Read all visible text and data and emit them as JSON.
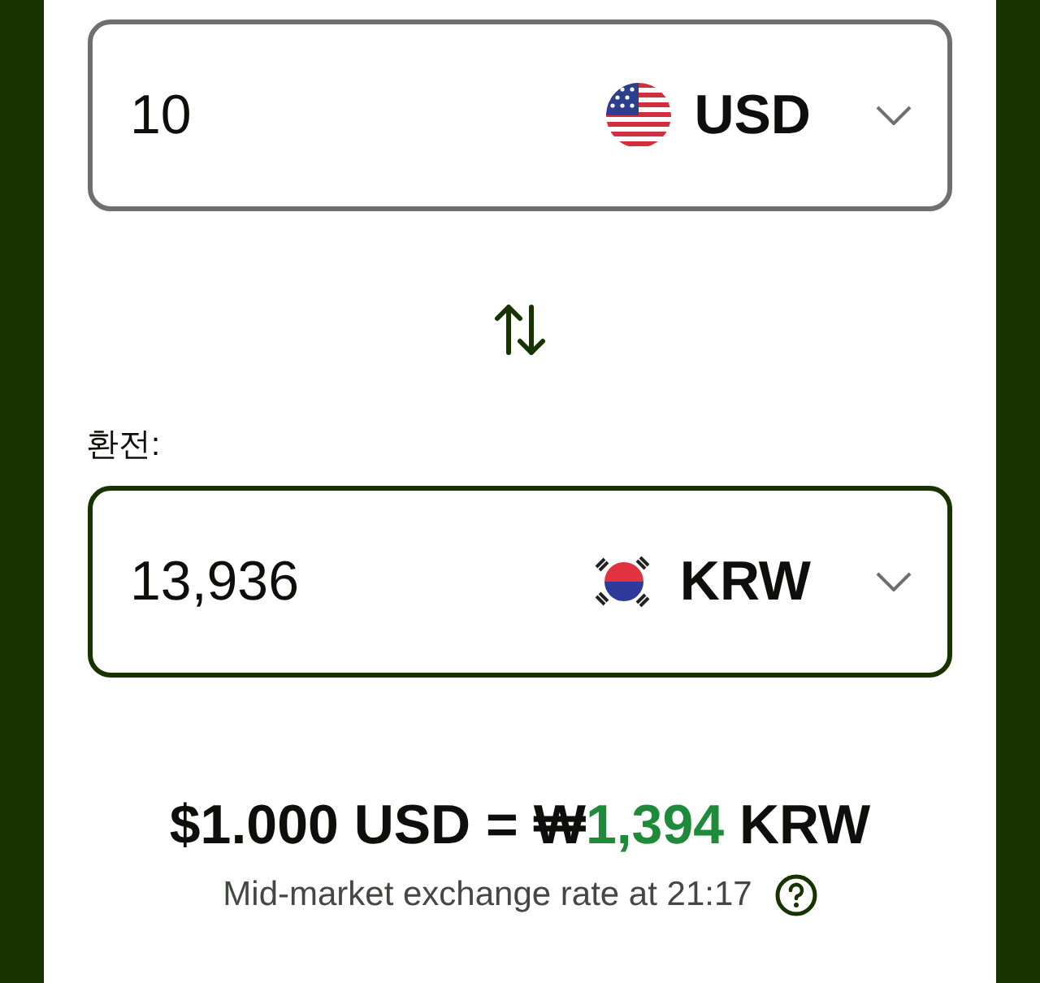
{
  "fields": [
    {
      "amount": "10",
      "currency": "USD",
      "focused": false
    },
    {
      "amount": "13,936",
      "currency": "KRW",
      "focused": true
    }
  ],
  "converted_label": "환전:",
  "rate": {
    "left": "$1.000 USD = ₩",
    "value": "1,394",
    "right": "KRW",
    "note": "Mid-market exchange rate at 21:17"
  }
}
